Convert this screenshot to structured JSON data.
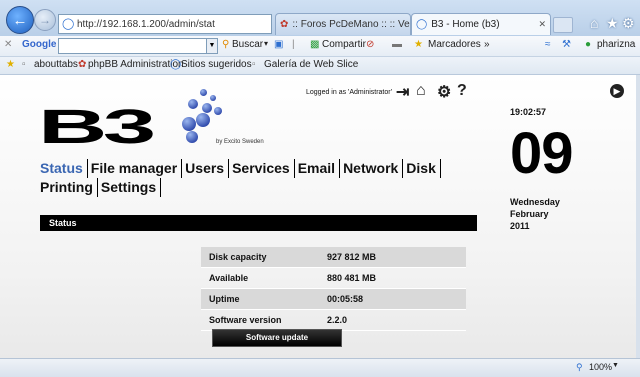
{
  "browser": {
    "address": "http://192.168.1.200/admin/stat",
    "tabs": [
      {
        "label": ":: Foros PcDeMano :: :: Ver te..."
      },
      {
        "label": "B3 - Home (b3)"
      }
    ],
    "toolbar": {
      "google_label": "Google",
      "buscar_label": "Buscar",
      "compartir_label": "Compartir",
      "marcadores_label": "Marcadores",
      "more_label": "»",
      "user_label": "pharizna"
    },
    "favorites": [
      {
        "label": "abouttabs"
      },
      {
        "label": "phpBB Administration"
      },
      {
        "label": "Sitios sugeridos"
      },
      {
        "label": "Galería de Web Slice"
      }
    ],
    "zoom": "100%"
  },
  "page": {
    "logo_text": "B3",
    "by_text": "by Excito Sweden",
    "logged_in": "Logged in as 'Administrator'",
    "nav": [
      {
        "label": "Status",
        "active": true
      },
      {
        "label": "File manager"
      },
      {
        "label": "Users"
      },
      {
        "label": "Services"
      },
      {
        "label": "Email"
      },
      {
        "label": "Network"
      },
      {
        "label": "Disk"
      },
      {
        "label": "Printing"
      },
      {
        "label": "Settings"
      }
    ],
    "section_title": "Status",
    "stats": [
      {
        "key": "Disk capacity",
        "value": "927 812 MB"
      },
      {
        "key": "Available",
        "value": "880 481 MB"
      },
      {
        "key": "Uptime",
        "value": "00:05:58"
      },
      {
        "key": "Software version",
        "value": "2.2.0"
      }
    ],
    "software_update_label": "Software update",
    "clock": {
      "time": "19:02:57",
      "day": "09",
      "weekday": "Wednesday",
      "month": "February",
      "year": "2011"
    }
  },
  "colors": {
    "accent": "#3a66b2",
    "bar": "#000000"
  }
}
